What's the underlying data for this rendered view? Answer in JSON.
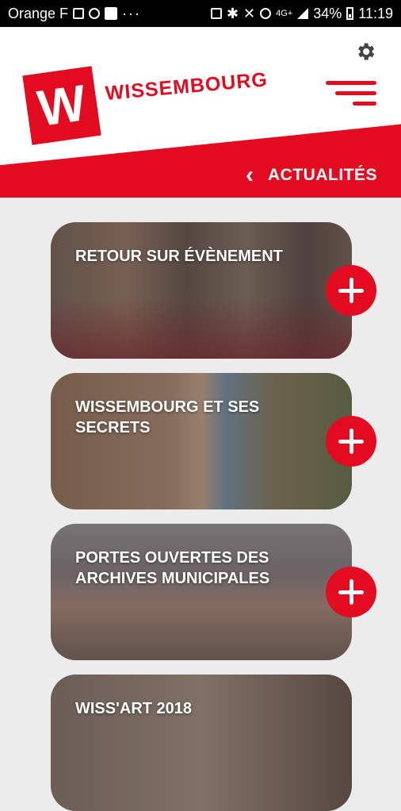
{
  "status_bar": {
    "carrier": "Orange F",
    "network": "4G+",
    "battery": "34%",
    "time": "11:19"
  },
  "header": {
    "logo_letter": "W",
    "brand": "WISSEMBOURG",
    "settings_icon": "gear-icon",
    "menu_icon": "hamburger-menu-icon",
    "back_icon": "chevron-left-icon",
    "section_title": "ACTUALITÉS"
  },
  "colors": {
    "brand_red": "#e30b1f",
    "background": "#ececec"
  },
  "news": [
    {
      "title": "RETOUR SUR ÉVÈNEMENT"
    },
    {
      "title": "WISSEMBOURG ET SES SECRETS"
    },
    {
      "title": "PORTES OUVERTES DES ARCHIVES MUNICIPALES"
    },
    {
      "title": "WISS'ART 2018"
    }
  ]
}
